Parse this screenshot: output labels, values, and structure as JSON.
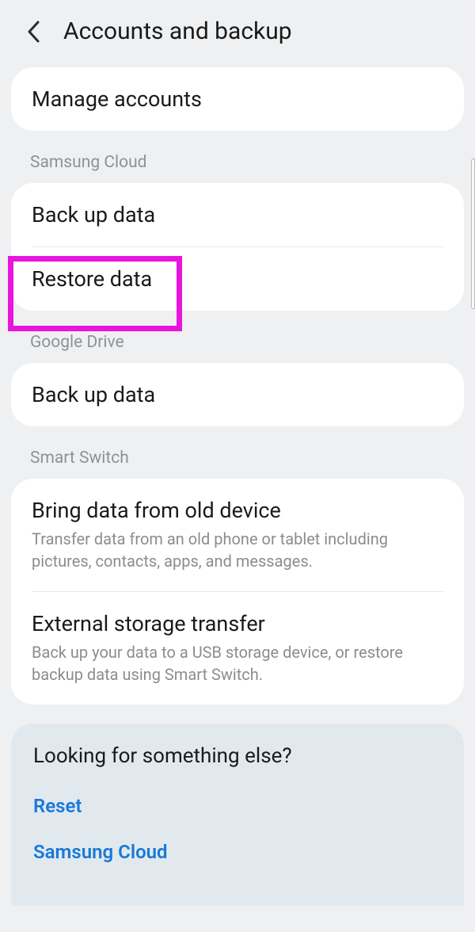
{
  "header": {
    "title": "Accounts and backup"
  },
  "manage": {
    "label": "Manage accounts"
  },
  "section_samsung": {
    "label": "Samsung Cloud",
    "backup": "Back up data",
    "restore": "Restore data"
  },
  "section_google": {
    "label": "Google Drive",
    "backup": "Back up data"
  },
  "section_smart": {
    "label": "Smart Switch",
    "bring_title": "Bring data from old device",
    "bring_sub": "Transfer data from an old phone or tablet including pictures, contacts, apps, and messages.",
    "ext_title": "External storage transfer",
    "ext_sub": "Back up your data to a USB storage device, or restore backup data using Smart Switch."
  },
  "footer": {
    "title": "Looking for something else?",
    "link_reset": "Reset",
    "link_samsung": "Samsung Cloud"
  }
}
